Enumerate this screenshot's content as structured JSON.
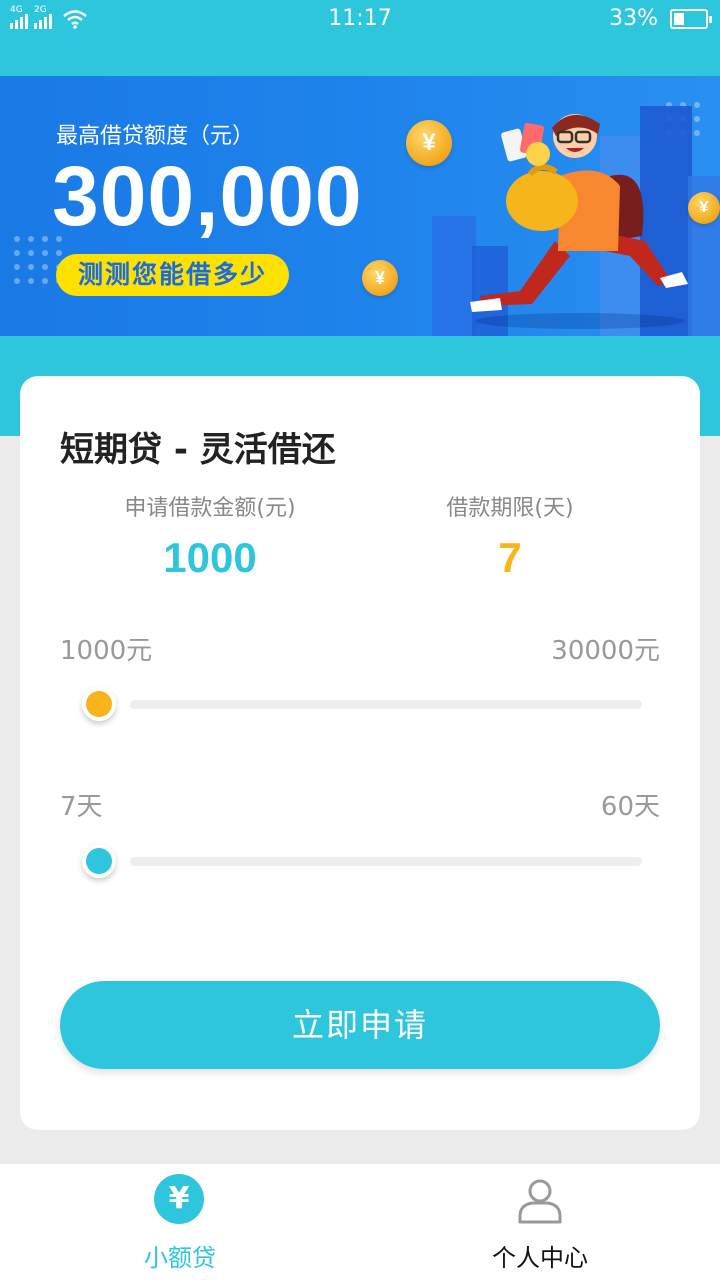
{
  "status_bar": {
    "time": "11:17",
    "battery_text": "33%",
    "battery_level": 0.33,
    "signal1_label": "4G",
    "signal2_label": "2G"
  },
  "banner": {
    "subtitle": "最高借贷额度（元）",
    "amount": "300,000",
    "cta": "测测您能借多少",
    "coin_symbol": "¥"
  },
  "card": {
    "title": "短期贷 - 灵活借还",
    "amount_label": "申请借款金额(元)",
    "amount_value": "1000",
    "term_label": "借款期限(天)",
    "term_value": "7",
    "amount_min": "1000元",
    "amount_max": "30000元",
    "term_min": "7天",
    "term_max": "60天",
    "amount_slider_level": 0,
    "term_slider_level": 0,
    "apply_button": "立即申请"
  },
  "tabbar": {
    "tab1_label": "小额贷",
    "tab1_icon": "¥",
    "tab2_label": "个人中心"
  },
  "colors": {
    "accent_teal": "#2ec6dc",
    "accent_yellow": "#f5b51b",
    "banner_blue": "#1f84ec"
  }
}
